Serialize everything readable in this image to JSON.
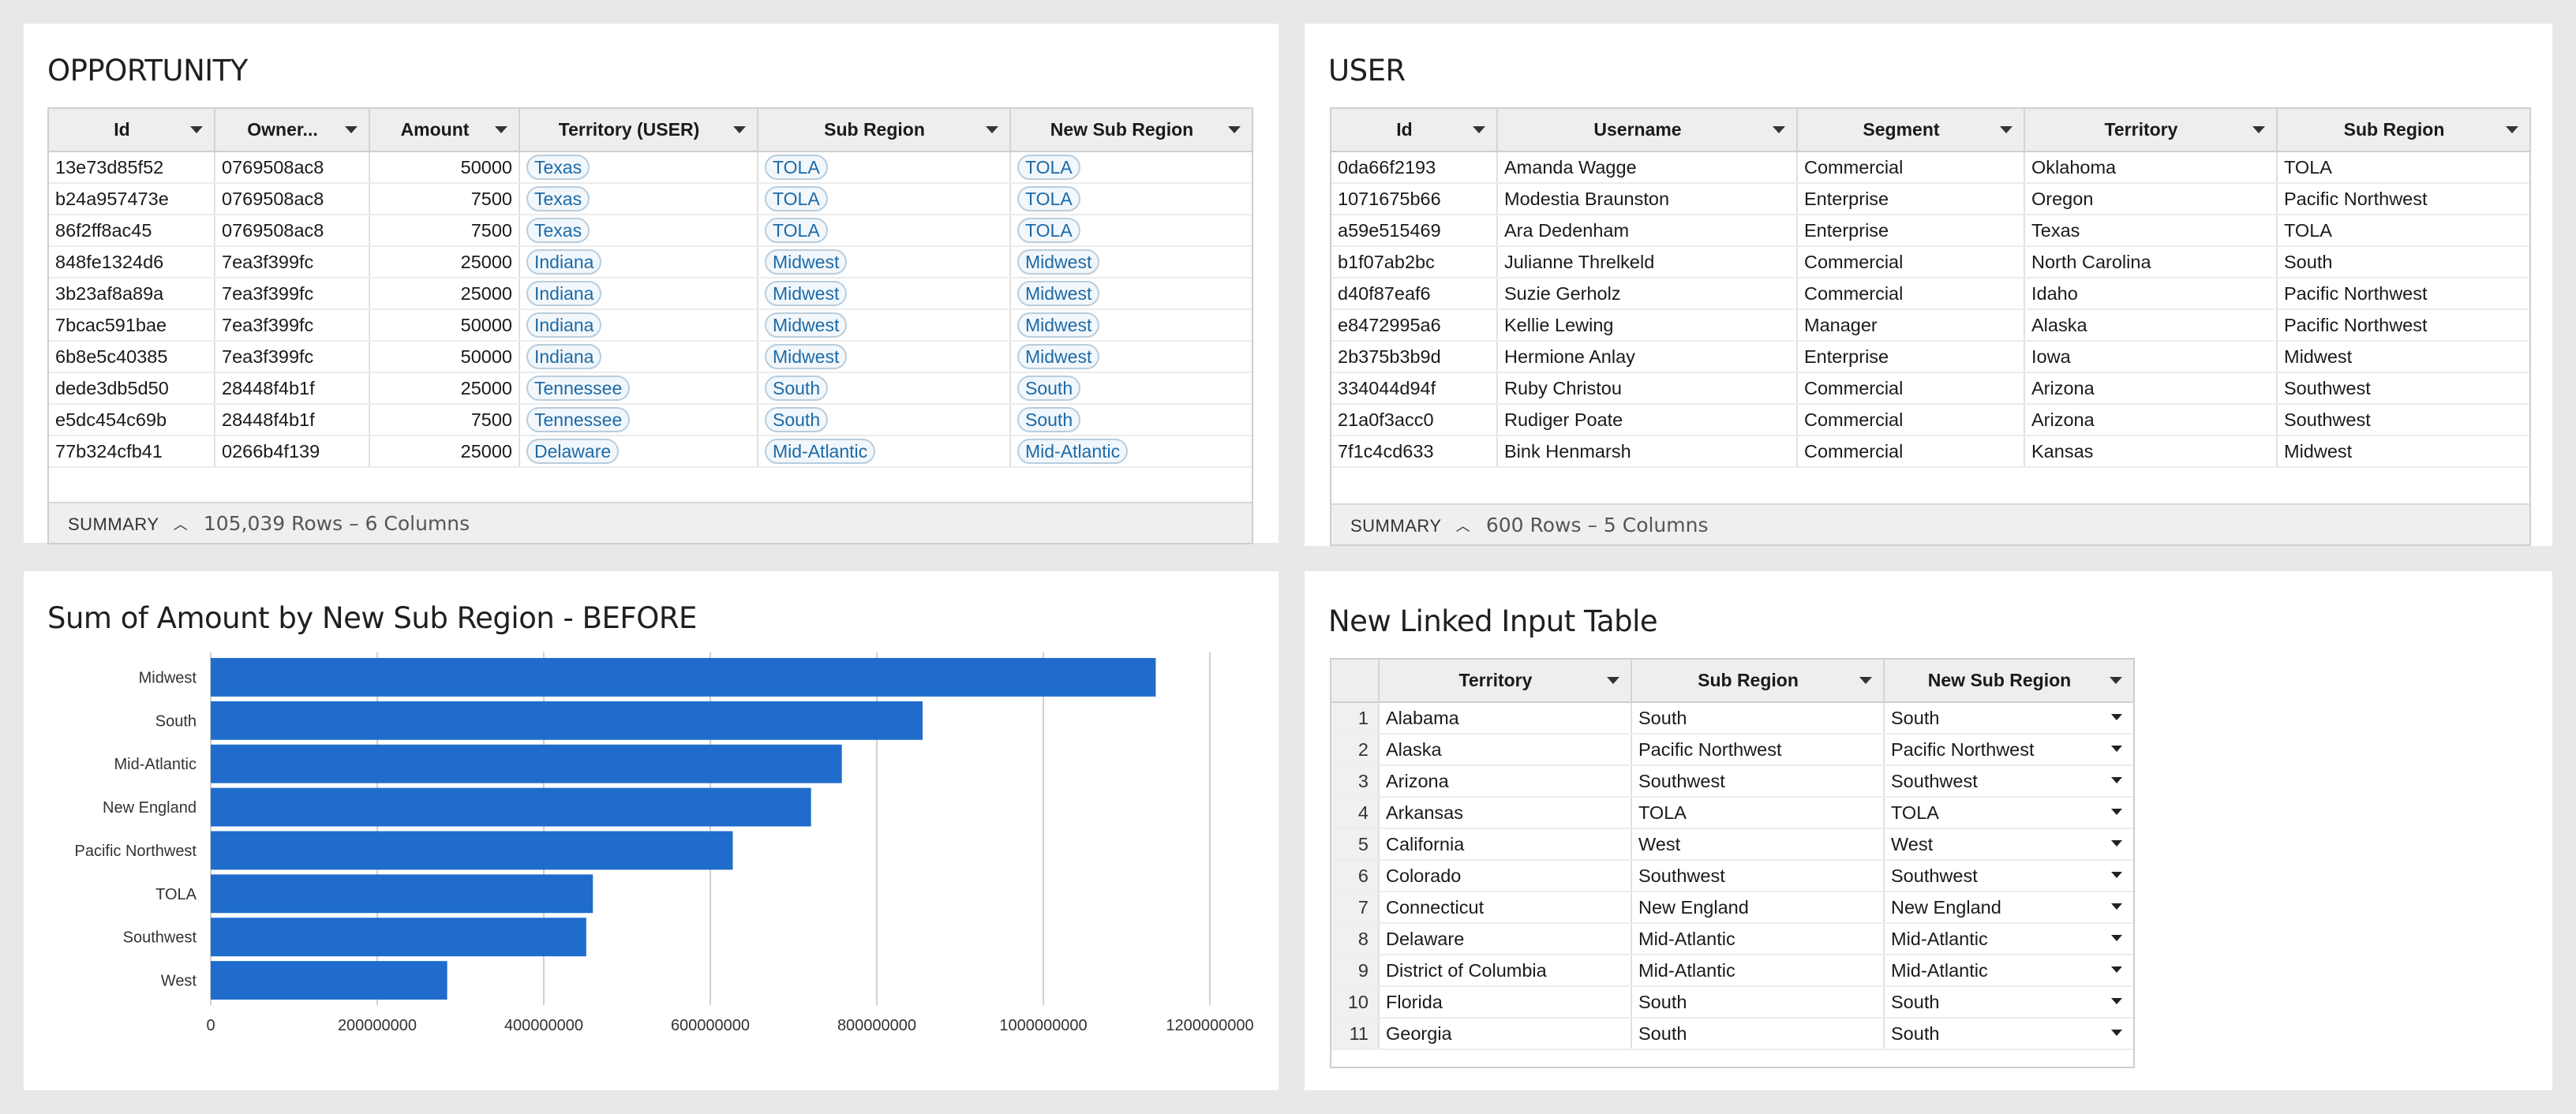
{
  "opportunity": {
    "title": "OPPORTUNITY",
    "columns": [
      "Id",
      "Owner...",
      "Amount",
      "Territory (USER)",
      "Sub Region",
      "New Sub Region"
    ],
    "rows": [
      [
        "13e73d85f52",
        "0769508ac8",
        "50000",
        "Texas",
        "TOLA",
        "TOLA"
      ],
      [
        "b24a957473e",
        "0769508ac8",
        "7500",
        "Texas",
        "TOLA",
        "TOLA"
      ],
      [
        "86f2ff8ac45",
        "0769508ac8",
        "7500",
        "Texas",
        "TOLA",
        "TOLA"
      ],
      [
        "848fe1324d6",
        "7ea3f399fc",
        "25000",
        "Indiana",
        "Midwest",
        "Midwest"
      ],
      [
        "3b23af8a89a",
        "7ea3f399fc",
        "25000",
        "Indiana",
        "Midwest",
        "Midwest"
      ],
      [
        "7bcac591bae",
        "7ea3f399fc",
        "50000",
        "Indiana",
        "Midwest",
        "Midwest"
      ],
      [
        "6b8e5c40385",
        "7ea3f399fc",
        "50000",
        "Indiana",
        "Midwest",
        "Midwest"
      ],
      [
        "dede3db5d50",
        "28448f4b1f",
        "25000",
        "Tennessee",
        "South",
        "South"
      ],
      [
        "e5dc454c69b",
        "28448f4b1f",
        "7500",
        "Tennessee",
        "South",
        "South"
      ],
      [
        "77b324cfb41",
        "0266b4f139",
        "25000",
        "Delaware",
        "Mid-Atlantic",
        "Mid-Atlantic"
      ]
    ],
    "summary_label": "SUMMARY",
    "summary_count": "105,039 Rows – 6 Columns"
  },
  "user": {
    "title": "USER",
    "columns": [
      "Id",
      "Username",
      "Segment",
      "Territory",
      "Sub Region"
    ],
    "rows": [
      [
        "0da66f2193",
        "Amanda Wagge",
        "Commercial",
        "Oklahoma",
        "TOLA"
      ],
      [
        "1071675b66",
        "Modestia Braunston",
        "Enterprise",
        "Oregon",
        "Pacific Northwest"
      ],
      [
        "a59e515469",
        "Ara Dedenham",
        "Enterprise",
        "Texas",
        "TOLA"
      ],
      [
        "b1f07ab2bc",
        "Julianne Threlkeld",
        "Commercial",
        "North Carolina",
        "South"
      ],
      [
        "d40f87eaf6",
        "Suzie Gerholz",
        "Commercial",
        "Idaho",
        "Pacific Northwest"
      ],
      [
        "e8472995a6",
        "Kellie Lewing",
        "Manager",
        "Alaska",
        "Pacific Northwest"
      ],
      [
        "2b375b3b9d",
        "Hermione Anlay",
        "Enterprise",
        "Iowa",
        "Midwest"
      ],
      [
        "334044d94f",
        "Ruby Christou",
        "Commercial",
        "Arizona",
        "Southwest"
      ],
      [
        "21a0f3acc0",
        "Rudiger Poate",
        "Commercial",
        "Arizona",
        "Southwest"
      ],
      [
        "7f1c4cd633",
        "Bink Henmarsh",
        "Commercial",
        "Kansas",
        "Midwest"
      ]
    ],
    "summary_label": "SUMMARY",
    "summary_count": "600 Rows – 5 Columns"
  },
  "chart": {
    "title": "Sum of Amount by New Sub Region - BEFORE",
    "bar_color": "#1f6ccd",
    "grid_color": "#d0d0d0"
  },
  "chart_data": {
    "type": "bar",
    "orientation": "horizontal",
    "title": "Sum of Amount by New Sub Region - BEFORE",
    "categories": [
      "Midwest",
      "South",
      "Mid-Atlantic",
      "New England",
      "Pacific Northwest",
      "TOLA",
      "Southwest",
      "West"
    ],
    "values": [
      1135000000,
      855000000,
      758000000,
      721000000,
      627000000,
      459000000,
      451000000,
      284000000
    ],
    "xlim": [
      0,
      1200000000
    ],
    "xticks": [
      "0",
      "200000000",
      "400000000",
      "600000000",
      "800000000",
      "1000000000",
      "1200000000"
    ],
    "xlabel": "",
    "ylabel": "",
    "grid": true
  },
  "linked": {
    "title": "New Linked Input Table",
    "columns": [
      "Territory",
      "Sub Region",
      "New Sub Region"
    ],
    "rows": [
      [
        "1",
        "Alabama",
        "South",
        "South"
      ],
      [
        "2",
        "Alaska",
        "Pacific Northwest",
        "Pacific Northwest"
      ],
      [
        "3",
        "Arizona",
        "Southwest",
        "Southwest"
      ],
      [
        "4",
        "Arkansas",
        "TOLA",
        "TOLA"
      ],
      [
        "5",
        "California",
        "West",
        "West"
      ],
      [
        "6",
        "Colorado",
        "Southwest",
        "Southwest"
      ],
      [
        "7",
        "Connecticut",
        "New England",
        "New England"
      ],
      [
        "8",
        "Delaware",
        "Mid-Atlantic",
        "Mid-Atlantic"
      ],
      [
        "9",
        "District of Columbia",
        "Mid-Atlantic",
        "Mid-Atlantic"
      ],
      [
        "10",
        "Florida",
        "South",
        "South"
      ],
      [
        "11",
        "Georgia",
        "South",
        "South"
      ]
    ]
  }
}
